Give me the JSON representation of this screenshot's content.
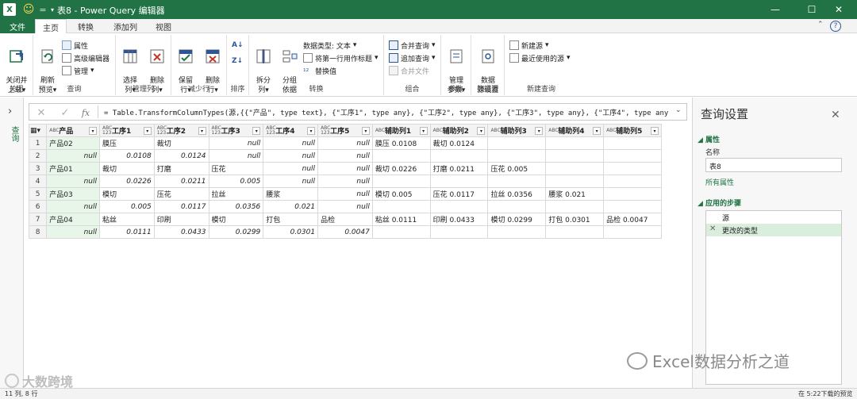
{
  "titlebar": {
    "title": "表8 - Power Query 编辑器",
    "excel_logo": "X",
    "quick_access_sep": "=",
    "minimize": "—",
    "maximize": "☐",
    "close": "✕"
  },
  "tabs": [
    {
      "label": "文件"
    },
    {
      "label": "主页"
    },
    {
      "label": "转换"
    },
    {
      "label": "添加列"
    },
    {
      "label": "视图"
    }
  ],
  "ribbon": {
    "close": {
      "button": "关闭并\n上载",
      "group": "关闭"
    },
    "query": {
      "refresh": "刷新\n预览",
      "properties": "属性",
      "advanced_editor": "高级编辑器",
      "manage": "管理",
      "group": "查询"
    },
    "manage_columns": {
      "choose": "选择\n列",
      "remove": "删除\n列",
      "group": "管理列"
    },
    "reduce_rows": {
      "keep": "保留\n行",
      "remove": "删除\n行",
      "group": "减少行"
    },
    "sort": {
      "group": "排序"
    },
    "transform": {
      "split": "拆分\n列",
      "groupby": "分组\n依据",
      "datatype": "数据类型: 文本",
      "first_row_header": "将第一行用作标题",
      "replace": "替换值",
      "group": "转换"
    },
    "combine": {
      "merge": "合并查询",
      "append": "追加查询",
      "combine_files": "合并文件",
      "group": "组合"
    },
    "params": {
      "manage": "管理\n参数",
      "group": "参数"
    },
    "datasource": {
      "settings": "数据\n源设置",
      "group": "数据源"
    },
    "newquery": {
      "new_source": "新建源",
      "recent": "最近使用的源",
      "group": "新建查询"
    }
  },
  "queries_pane": {
    "label": "查询"
  },
  "formula": {
    "text": "= Table.TransformColumnTypes(源,{{\"产品\", type text}, {\"工序1\", type any}, {\"工序2\", type any}, {\"工序3\", type any}, {\"工序4\", type any},"
  },
  "grid": {
    "columns": [
      {
        "type": "ABC",
        "label": "产品"
      },
      {
        "type": "ABC\n123",
        "label": "工序1"
      },
      {
        "type": "ABC\n123",
        "label": "工序2"
      },
      {
        "type": "ABC\n123",
        "label": "工序3"
      },
      {
        "type": "ABC\n123",
        "label": "工序4"
      },
      {
        "type": "ABC\n123",
        "label": "工序5"
      },
      {
        "type": "ABC",
        "label": "辅助列1"
      },
      {
        "type": "ABC",
        "label": "辅助列2"
      },
      {
        "type": "ABC",
        "label": "辅助列3"
      },
      {
        "type": "ABC",
        "label": "辅助列4"
      },
      {
        "type": "ABC",
        "label": "辅助列5"
      }
    ],
    "rows": [
      [
        "1",
        "产品02",
        "膜压",
        "裁切",
        "null",
        "null",
        "null",
        "膜压 0.0108",
        "裁切 0.0124",
        "",
        "",
        ""
      ],
      [
        "2",
        "null",
        "0.0108",
        "0.0124",
        "null",
        "null",
        "null",
        "",
        "",
        "",
        "",
        ""
      ],
      [
        "3",
        "产品01",
        "裁切",
        "打磨",
        "压花",
        "null",
        "null",
        "裁切 0.0226",
        "打磨 0.0211",
        "压花 0.005",
        "",
        ""
      ],
      [
        "4",
        "null",
        "0.0226",
        "0.0211",
        "0.005",
        "null",
        "null",
        "",
        "",
        "",
        "",
        ""
      ],
      [
        "5",
        "产品03",
        "模切",
        "压花",
        "拉丝",
        "腰浆",
        "null",
        "模切 0.005",
        "压花 0.0117",
        "拉丝 0.0356",
        "腰浆 0.021",
        ""
      ],
      [
        "6",
        "null",
        "0.005",
        "0.0117",
        "0.0356",
        "0.021",
        "null",
        "",
        "",
        "",
        "",
        ""
      ],
      [
        "7",
        "产品04",
        "粘丝",
        "印刷",
        "模切",
        "打包",
        "品检",
        "粘丝 0.0111",
        "印刷 0.0433",
        "模切 0.0299",
        "打包 0.0301",
        "品检 0.0047"
      ],
      [
        "8",
        "null",
        "0.0111",
        "0.0433",
        "0.0299",
        "0.0301",
        "0.0047",
        "",
        "",
        "",
        "",
        ""
      ]
    ]
  },
  "settings": {
    "title": "查询设置",
    "properties_head": "◢ 属性",
    "name_label": "名称",
    "name_value": "表8",
    "all_properties": "所有属性",
    "steps_head": "◢ 应用的步骤",
    "steps": [
      {
        "label": "源",
        "active": false
      },
      {
        "label": "更改的类型",
        "active": true
      }
    ]
  },
  "status": {
    "left": "11 列, 8 行",
    "right": "在 5:22下载的预览"
  },
  "watermark": {
    "right": "Excel数据分析之道",
    "left": "大数跨境"
  }
}
